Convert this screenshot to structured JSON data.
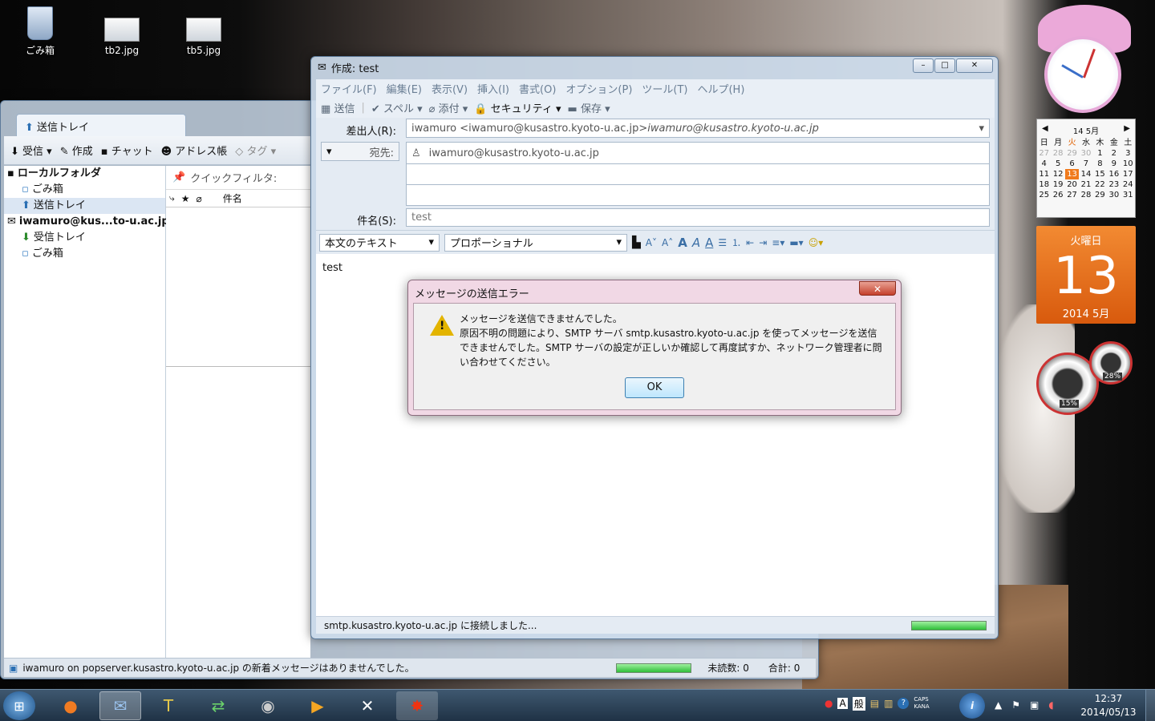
{
  "desktop": {
    "icons": [
      {
        "label": "ごみ箱",
        "icon": "recycle-bin-icon"
      },
      {
        "label": "tb2.jpg",
        "icon": "image-file-icon"
      },
      {
        "label": "tb5.jpg",
        "icon": "image-file-icon"
      }
    ]
  },
  "mail_window": {
    "tab_label": "送信トレイ",
    "toolbar": {
      "receive": "受信",
      "compose": "作成",
      "chat": "チャット",
      "address_book": "アドレス帳",
      "tag": "タグ"
    },
    "folders": [
      {
        "label": "ローカルフォルダ",
        "level": 0
      },
      {
        "label": "ごみ箱",
        "level": 1
      },
      {
        "label": "送信トレイ",
        "level": 1
      },
      {
        "label": "iwamuro@kus...to-u.ac.jp",
        "level": 0
      },
      {
        "label": "受信トレイ",
        "level": 1
      },
      {
        "label": "ごみ箱",
        "level": 1
      }
    ],
    "quick_filter_label": "クイックフィルタ:",
    "column_subject": "件名",
    "status_text": "iwamuro on popserver.kusastro.kyoto-u.ac.jp の新着メッセージはありませんでした。",
    "unread_label": "未読数: 0",
    "total_label": "合計: 0"
  },
  "compose_window": {
    "title": "作成: test",
    "menus": [
      "ファイル(F)",
      "編集(E)",
      "表示(V)",
      "挿入(I)",
      "書式(O)",
      "オプション(P)",
      "ツール(T)",
      "ヘルプ(H)"
    ],
    "toolbar": {
      "send": "送信",
      "spell": "スペル",
      "attach": "添付",
      "security": "セキュリティ",
      "save": "保存"
    },
    "from_label": "差出人(R):",
    "from_value": "iwamuro <iwamuro@kusastro.kyoto-u.ac.jp>",
    "from_identity": "iwamuro@kusastro.kyoto-u.ac.jp",
    "to_type": "宛先:",
    "to_value": "iwamuro@kusastro.kyoto-u.ac.jp",
    "subject_label": "件名(S):",
    "subject_value": "test",
    "format_paragraph": "本文のテキスト",
    "format_font": "プロポーショナル",
    "body_text": "test",
    "status_text": "smtp.kusastro.kyoto-u.ac.jp に接続しました..."
  },
  "dialog": {
    "title": "メッセージの送信エラー",
    "line1": "メッセージを送信できませんでした。",
    "line2": "原因不明の問題により、SMTP サーバ smtp.kusastro.kyoto-u.ac.jp を使ってメッセージを送信",
    "line3": "できませんでした。SMTP サーバの設定が正しいか確認して再度試すか、ネットワーク管理者に問",
    "line4": "い合わせてください。",
    "ok_label": "OK"
  },
  "gadgets": {
    "calendar_header": "14 5月",
    "weekdays": [
      "日",
      "月",
      "火",
      "水",
      "木",
      "金",
      "土"
    ],
    "days": [
      "27",
      "28",
      "29",
      "30",
      "1",
      "2",
      "3",
      "4",
      "5",
      "6",
      "7",
      "8",
      "9",
      "10",
      "11",
      "12",
      "13",
      "14",
      "15",
      "16",
      "17",
      "18",
      "19",
      "20",
      "21",
      "22",
      "23",
      "24",
      "25",
      "26",
      "27",
      "28",
      "29",
      "30",
      "31"
    ],
    "today_weekday": "火曜日",
    "today_day": "13",
    "today_month": "2014 5月",
    "cpu_percent": "15%",
    "mem_percent": "28%"
  },
  "taskbar": {
    "clock_time": "12:37",
    "clock_date": "2014/05/13",
    "ime_mode": "般",
    "caps": "CAPS",
    "kana": "KANA"
  }
}
